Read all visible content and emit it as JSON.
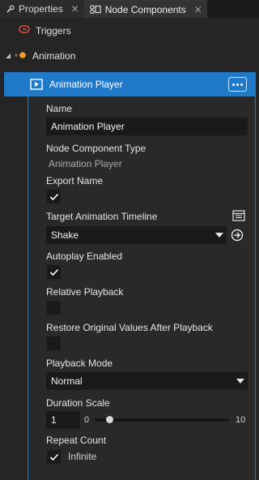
{
  "tabs": [
    {
      "label": "Properties",
      "active": false
    },
    {
      "label": "Node Components",
      "active": true
    }
  ],
  "tree": {
    "triggers_label": "Triggers",
    "animation_label": "Animation",
    "selected_label": "Animation Player"
  },
  "properties": {
    "name_label": "Name",
    "name_value": "Animation Player",
    "type_label": "Node Component Type",
    "type_value": "Animation Player",
    "export_name_label": "Export Name",
    "export_name_checked": true,
    "timeline_label": "Target Animation Timeline",
    "timeline_value": "Shake",
    "autoplay_label": "Autoplay Enabled",
    "autoplay_checked": true,
    "relative_label": "Relative Playback",
    "relative_checked": false,
    "restore_label": "Restore Original Values After Playback",
    "restore_checked": false,
    "mode_label": "Playback Mode",
    "mode_value": "Normal",
    "duration_label": "Duration Scale",
    "duration_value": "1",
    "duration_min": "0",
    "duration_max": "10",
    "repeat_label": "Repeat Count",
    "infinite_label": "Infinite",
    "infinite_checked": true
  },
  "colors": {
    "accent": "#1f7bc9",
    "background": "#252525",
    "field": "#1a1a1a",
    "trigger_icon": "#e04b4b",
    "animation_icon": "#f0a020"
  },
  "icons": {
    "properties_tab": "wrench-icon",
    "components_tab": "node-components-icon",
    "triggers": "trigger-icon",
    "animation": "animation-icon",
    "player": "animation-player-icon",
    "timeline_button": "timeline-icon",
    "go_to": "go-to-arrow-icon"
  }
}
